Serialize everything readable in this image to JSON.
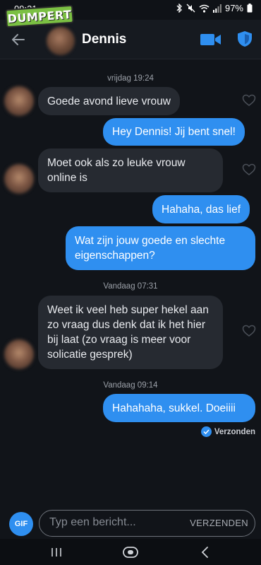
{
  "status_bar": {
    "time": "09:21",
    "battery": "97%"
  },
  "watermark": {
    "text": "DUMPERT"
  },
  "header": {
    "back_icon": "arrow-left-icon",
    "contact_name": "Dennis",
    "video_icon": "video-camera-icon",
    "safety_icon": "shield-icon",
    "accent_color": "#2f8ff0"
  },
  "chat": {
    "day_labels": [
      "vrijdag 19:24",
      "Vandaag 07:31",
      "Vandaag 09:14"
    ],
    "messages": [
      {
        "from": "them",
        "text": "Goede avond lieve vrouw"
      },
      {
        "from": "me",
        "text": "Hey Dennis! Jij bent snel!"
      },
      {
        "from": "them",
        "text": "Moet ook als zo leuke vrouw online is"
      },
      {
        "from": "me",
        "text": "Hahaha, das lief"
      },
      {
        "from": "me",
        "text": "Wat zijn jouw goede en slechte eigenschappen?"
      },
      {
        "from": "them",
        "text": "Weet ik veel heb super hekel aan zo vraag dus denk dat ik het hier bij laat (zo vraag is meer voor solicatie gesprek)"
      },
      {
        "from": "me",
        "text": "Hahahaha, sukkel. Doeiiii"
      }
    ],
    "sent_status": "Verzonden"
  },
  "composer": {
    "gif_label": "GIF",
    "placeholder": "Typ een bericht...",
    "send_label": "VERZENDEN"
  },
  "nav_bar": {
    "icons": [
      "recent-apps-icon",
      "home-icon",
      "back-icon"
    ]
  }
}
